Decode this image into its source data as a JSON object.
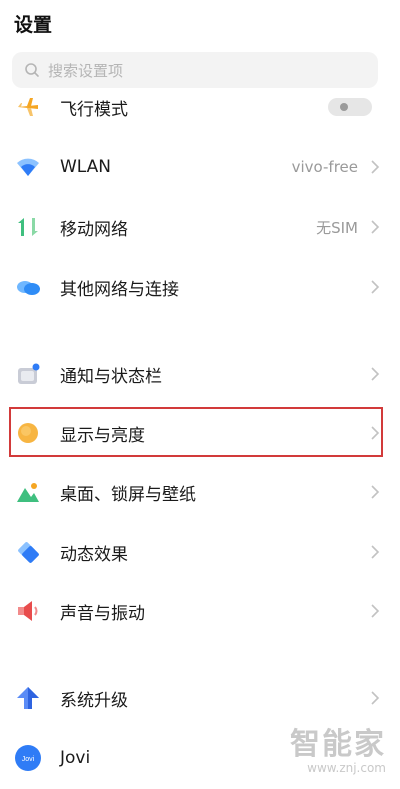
{
  "page": {
    "title": "设置"
  },
  "search": {
    "placeholder": "搜索设置项"
  },
  "items": [
    {
      "label": "飞行模式",
      "icon": "airplane-icon",
      "control": "toggle",
      "toggle_on": false
    },
    {
      "label": "WLAN",
      "icon": "wifi-icon",
      "value": "vivo-free"
    },
    {
      "label": "移动网络",
      "icon": "mobile-data-icon",
      "value": "无SIM"
    },
    {
      "label": "其他网络与连接",
      "icon": "cloud-network-icon"
    },
    {
      "label": "通知与状态栏",
      "icon": "notification-icon"
    },
    {
      "label": "显示与亮度",
      "icon": "sun-icon"
    },
    {
      "label": "桌面、锁屏与壁纸",
      "icon": "wallpaper-icon"
    },
    {
      "label": "动态效果",
      "icon": "animation-icon"
    },
    {
      "label": "声音与振动",
      "icon": "speaker-icon"
    },
    {
      "label": "系统升级",
      "icon": "upgrade-arrow-icon"
    },
    {
      "label": "Jovi",
      "icon": "jovi-icon",
      "badge": "Jovi"
    }
  ],
  "watermark": {
    "logo": "智能家",
    "url": "www.znj.com"
  },
  "colors": {
    "highlight": "#d23a3a",
    "accent_blue": "#2f7cf6",
    "airplane": "#f5a623",
    "sun": "#f7b542"
  }
}
